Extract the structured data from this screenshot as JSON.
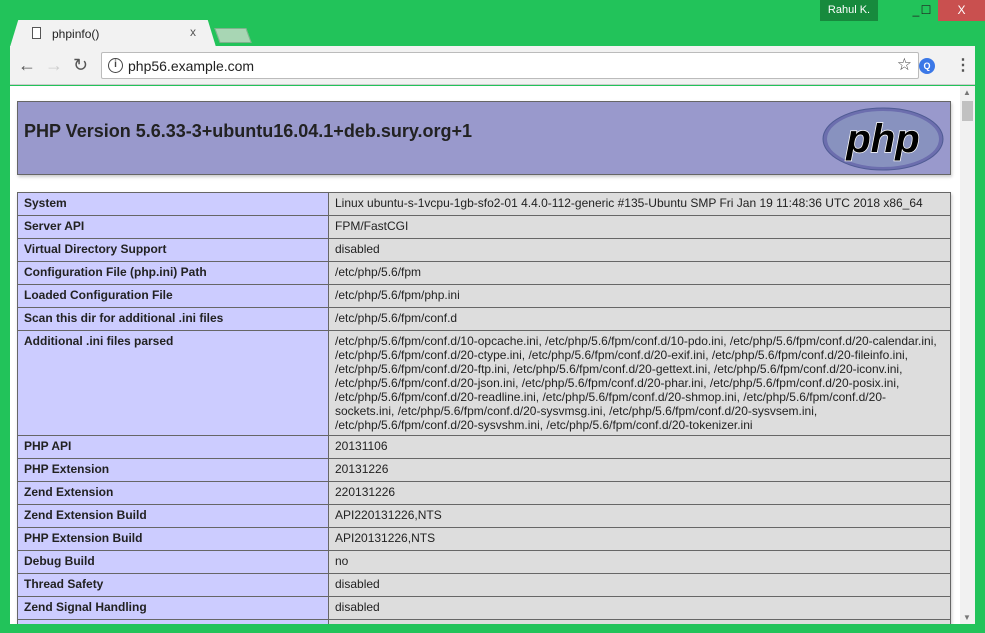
{
  "window": {
    "user": "Rahul K.",
    "minimize": "_",
    "maximize": "☐",
    "close": "X"
  },
  "tab": {
    "title": "phpinfo()",
    "close": "x"
  },
  "toolbar": {
    "back": "←",
    "forward": "→",
    "reload": "↻",
    "url": "php56.example.com",
    "info": "i",
    "star": "☆",
    "ext": "Q",
    "menu": "⋮"
  },
  "page": {
    "title": "PHP Version 5.6.33-3+ubuntu16.04.1+deb.sury.org+1",
    "logo_text": "php",
    "rows": [
      {
        "k": "System",
        "v": "Linux ubuntu-s-1vcpu-1gb-sfo2-01 4.4.0-112-generic #135-Ubuntu SMP Fri Jan 19 11:48:36 UTC 2018 x86_64"
      },
      {
        "k": "Server API",
        "v": "FPM/FastCGI"
      },
      {
        "k": "Virtual Directory Support",
        "v": "disabled"
      },
      {
        "k": "Configuration File (php.ini) Path",
        "v": "/etc/php/5.6/fpm"
      },
      {
        "k": "Loaded Configuration File",
        "v": "/etc/php/5.6/fpm/php.ini"
      },
      {
        "k": "Scan this dir for additional .ini files",
        "v": "/etc/php/5.6/fpm/conf.d"
      },
      {
        "k": "Additional .ini files parsed",
        "v": "/etc/php/5.6/fpm/conf.d/10-opcache.ini, /etc/php/5.6/fpm/conf.d/10-pdo.ini, /etc/php/5.6/fpm/conf.d/20-calendar.ini, /etc/php/5.6/fpm/conf.d/20-ctype.ini, /etc/php/5.6/fpm/conf.d/20-exif.ini, /etc/php/5.6/fpm/conf.d/20-fileinfo.ini, /etc/php/5.6/fpm/conf.d/20-ftp.ini, /etc/php/5.6/fpm/conf.d/20-gettext.ini, /etc/php/5.6/fpm/conf.d/20-iconv.ini, /etc/php/5.6/fpm/conf.d/20-json.ini, /etc/php/5.6/fpm/conf.d/20-phar.ini, /etc/php/5.6/fpm/conf.d/20-posix.ini, /etc/php/5.6/fpm/conf.d/20-readline.ini, /etc/php/5.6/fpm/conf.d/20-shmop.ini, /etc/php/5.6/fpm/conf.d/20-sockets.ini, /etc/php/5.6/fpm/conf.d/20-sysvmsg.ini, /etc/php/5.6/fpm/conf.d/20-sysvsem.ini, /etc/php/5.6/fpm/conf.d/20-sysvshm.ini, /etc/php/5.6/fpm/conf.d/20-tokenizer.ini"
      },
      {
        "k": "PHP API",
        "v": "20131106"
      },
      {
        "k": "PHP Extension",
        "v": "20131226"
      },
      {
        "k": "Zend Extension",
        "v": "220131226"
      },
      {
        "k": "Zend Extension Build",
        "v": "API220131226,NTS"
      },
      {
        "k": "PHP Extension Build",
        "v": "API20131226,NTS"
      },
      {
        "k": "Debug Build",
        "v": "no"
      },
      {
        "k": "Thread Safety",
        "v": "disabled"
      },
      {
        "k": "Zend Signal Handling",
        "v": "disabled"
      },
      {
        "k": "",
        "v": ""
      }
    ]
  }
}
